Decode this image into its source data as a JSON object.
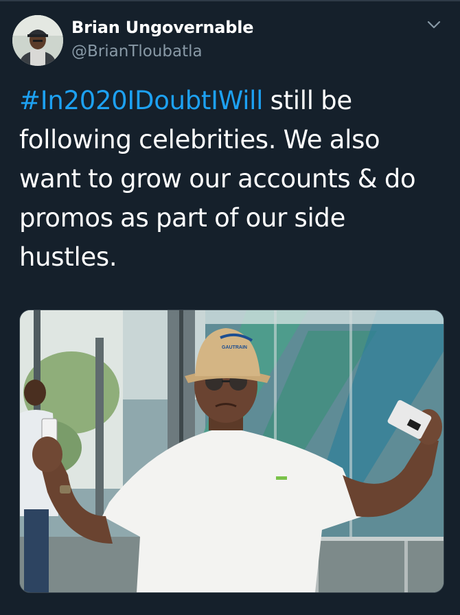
{
  "tweet": {
    "author": {
      "display_name": "Brian Ungovernable",
      "handle": "@BrianTloubatla"
    },
    "hashtag": "#In2020IDoubtIWill",
    "text_lines": [
      " still be",
      "following celebrities. We also",
      "want to grow our accounts & do",
      "promos as part of our side",
      "hustles."
    ],
    "media": {
      "hat_logo_text": "GAUTRAIN"
    }
  },
  "colors": {
    "background": "#15202b",
    "hashtag": "#1da1f2",
    "secondary_text": "#8899a6",
    "divider": "#38444d"
  },
  "icons": {
    "menu": "chevron-down-icon"
  }
}
